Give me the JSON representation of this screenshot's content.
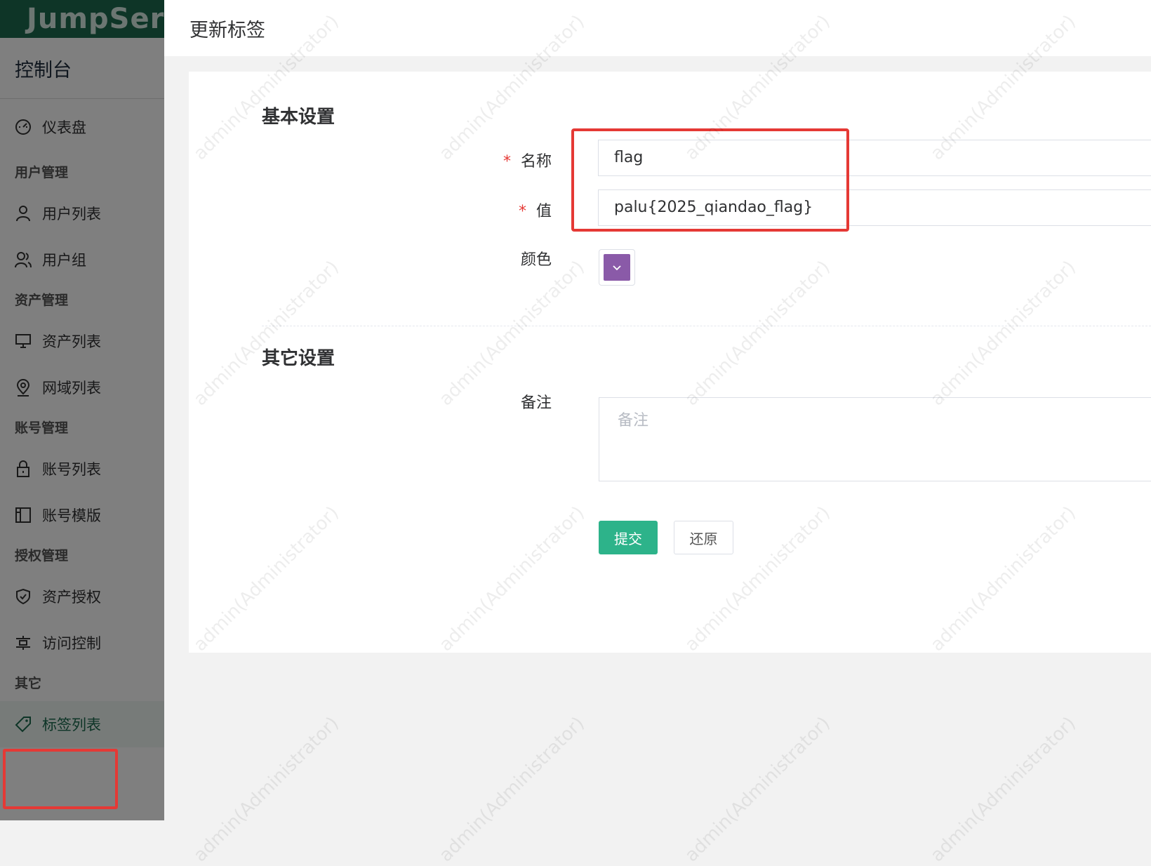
{
  "brand": {
    "name": "JumpSer"
  },
  "sidebar": {
    "console_label": "控制台",
    "dashboard": "仪表盘",
    "groups": [
      {
        "title": "用户管理",
        "items": [
          "用户列表",
          "用户组"
        ]
      },
      {
        "title": "资产管理",
        "items": [
          "资产列表",
          "网域列表"
        ]
      },
      {
        "title": "账号管理",
        "items": [
          "账号列表",
          "账号模版"
        ]
      },
      {
        "title": "授权管理",
        "items": [
          "资产授权",
          "访问控制"
        ]
      },
      {
        "title": "其它",
        "items": [
          "标签列表"
        ]
      }
    ]
  },
  "panel": {
    "title": "更新标签",
    "basic_section": "基本设置",
    "other_section": "其它设置",
    "fields": {
      "name_label": "名称",
      "name_value": "flag",
      "value_label": "值",
      "value_value": "palu{2025_qiandao_flag}",
      "color_label": "颜色",
      "color_value": "#8a5aa8",
      "comment_label": "备注",
      "comment_placeholder": "备注"
    },
    "buttons": {
      "submit": "提交",
      "reset": "还原"
    }
  },
  "watermark": "admin(Administrator)"
}
